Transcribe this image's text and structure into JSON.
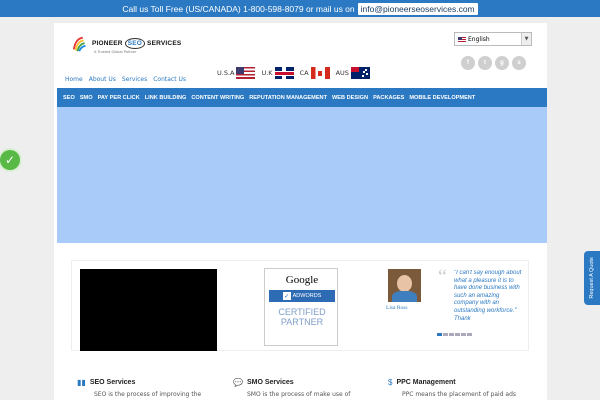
{
  "topbar": {
    "call_text": "Call us Toll Free (US/CANADA) 1-800-598-8079 or mail us on",
    "email": "info@pioneerseoservices.com"
  },
  "logo": {
    "brand_left": "PIONEER",
    "brand_seo": "SEO",
    "brand_right": "SERVICES",
    "tagline": "A Trusted Global Partner"
  },
  "language": {
    "selected": "English"
  },
  "social": {
    "icons": [
      "facebook-icon",
      "twitter-icon",
      "google-plus-icon",
      "skype-icon"
    ]
  },
  "nav_small": [
    "Home",
    "About Us",
    "Services",
    "Contact Us"
  ],
  "countries": [
    "U.S.A",
    "U.K",
    "CA",
    "AUS"
  ],
  "main_nav": [
    "SEO",
    "SMO",
    "PAY PER CLICK",
    "LINK BUILDING",
    "CONTENT WRITING",
    "REPUTATION MANAGEMENT",
    "WEB DESIGN",
    "PACKAGES",
    "MOBILE DEVELOPMENT"
  ],
  "badge": {
    "google": "Google",
    "adwords": "ADWORDS",
    "certified": "CERTIFIED",
    "partner": "PARTNER"
  },
  "testimonial": {
    "name": "Lisa Ross",
    "quote": "\"I can't say enough about what a pleasure it is to have done business with such an amazing company with an outstanding workforce.\" Thank"
  },
  "services": [
    {
      "title": "SEO Services",
      "desc": "SEO is the process of improving the"
    },
    {
      "title": "SMO Services",
      "desc": "SMO is the process of make use of"
    },
    {
      "title": "PPC Management",
      "desc": "PPC means the placement of paid ads"
    }
  ],
  "side_tab": "Request A Quote",
  "colors": {
    "brand_blue": "#2b79c2",
    "hero": "#a9cbfa",
    "check_green": "#58b947"
  }
}
